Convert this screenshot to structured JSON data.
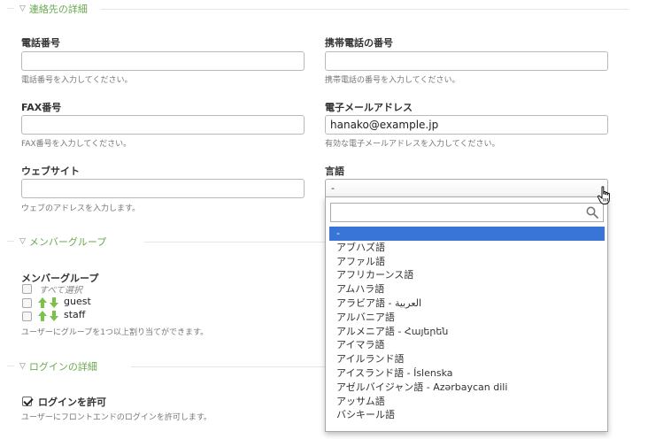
{
  "sections": {
    "contact": "連絡先の詳細",
    "member_group": "メンバーグループ",
    "login": "ログインの詳細"
  },
  "fields": {
    "phone": {
      "label": "電話番号",
      "value": "",
      "help": "電話番号を入力してください。"
    },
    "mobile": {
      "label": "携帯電話の番号",
      "value": "",
      "help": "携帯電話の番号を入力してください。"
    },
    "fax": {
      "label": "FAX番号",
      "value": "",
      "help": "FAX番号を入力してください。"
    },
    "email": {
      "label": "電子メールアドレス",
      "value": "hanako@example.jp",
      "help": "有効な電子メールアドレスを入力してください。"
    },
    "website": {
      "label": "ウェブサイト",
      "value": "",
      "help": "ウェブのアドレスを入力します。"
    },
    "language": {
      "label": "言語",
      "value": "-"
    }
  },
  "member_group": {
    "label": "メンバーグループ",
    "select_all": "すべて選択",
    "groups": [
      "guest",
      "staff"
    ],
    "help": "ユーザーにグループを1つ以上割り当てができます。"
  },
  "login": {
    "allow_label": "ログインを許可",
    "allow_checked": true,
    "help": "ユーザーにフロントエンドのログインを許可します。"
  },
  "dropdown": {
    "search_value": "",
    "selected_index": 0,
    "options": [
      "-",
      "アブハズ語",
      "アファル語",
      "アフリカーンス語",
      "アムハラ語",
      "アラビア語 - العربية",
      "アルバニア語",
      "アルメニア語 - Հայերեն",
      "アイマラ語",
      "アイルランド語",
      "アイスランド語 - Íslenska",
      "アゼルバイジャン語 - Azərbaycan dili",
      "アッサム語",
      "バシキール語"
    ]
  },
  "colors": {
    "accent_green": "#6aa84f",
    "selection_blue": "#3875d7"
  }
}
